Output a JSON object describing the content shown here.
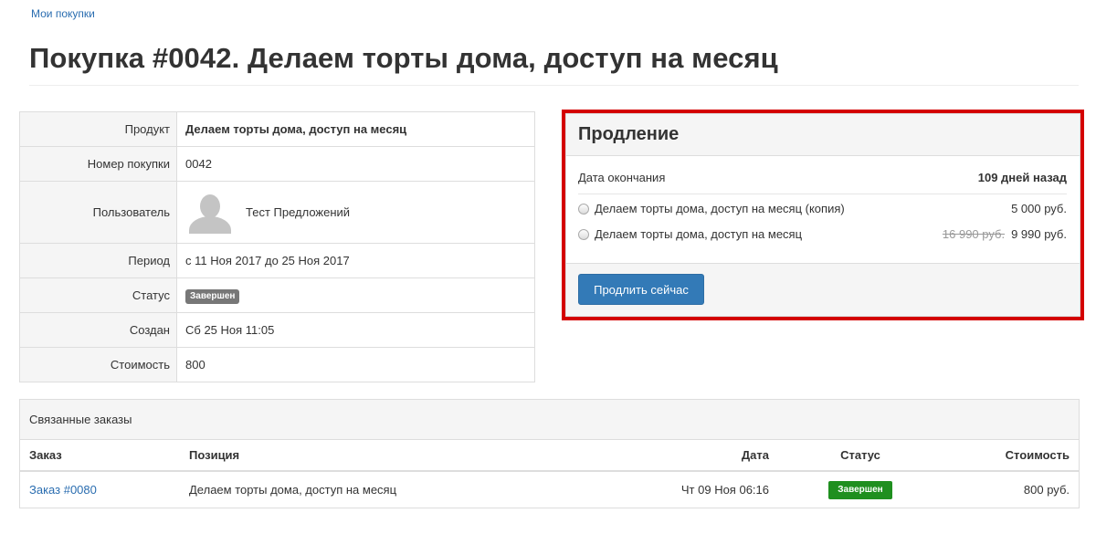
{
  "breadcrumb": {
    "label": "Мои покупки"
  },
  "page": {
    "title": "Покупка #0042. Делаем торты дома, доступ на месяц"
  },
  "info": {
    "product_label": "Продукт",
    "product_value": "Делаем торты дома, доступ на месяц",
    "number_label": "Номер покупки",
    "number_value": "0042",
    "user_label": "Пользователь",
    "user_value": "Тест Предложений",
    "period_label": "Период",
    "period_value": "с 11 Ноя 2017 до 25 Ноя 2017",
    "status_label": "Статус",
    "status_value": "Завершен",
    "created_label": "Создан",
    "created_value": "Сб 25 Ноя 11:05",
    "cost_label": "Стоимость",
    "cost_value": "800"
  },
  "renewal": {
    "title": "Продление",
    "end_label": "Дата окончания",
    "end_value": "109 дней назад",
    "options": [
      {
        "label": "Делаем торты дома, доступ на месяц (копия)",
        "price": "5 000 руб."
      },
      {
        "label": "Делаем торты дома, доступ на месяц",
        "old_price": "16 990 руб.",
        "price": "9 990 руб."
      }
    ],
    "button_label": "Продлить сейчас",
    "highlight_color": "#d40000"
  },
  "orders": {
    "title": "Связанные заказы",
    "columns": [
      "Заказ",
      "Позиция",
      "Дата",
      "Статус",
      "Стоимость"
    ],
    "rows": [
      {
        "order": "Заказ #0080",
        "position": "Делаем торты дома, доступ на месяц",
        "date": "Чт 09 Ноя 06:16",
        "status": "Завершен",
        "cost": "800 руб."
      }
    ]
  },
  "colors": {
    "link": "#2a6db0",
    "primary": "#337ab7",
    "success": "#1f8f1f",
    "muted_badge": "#777777"
  }
}
